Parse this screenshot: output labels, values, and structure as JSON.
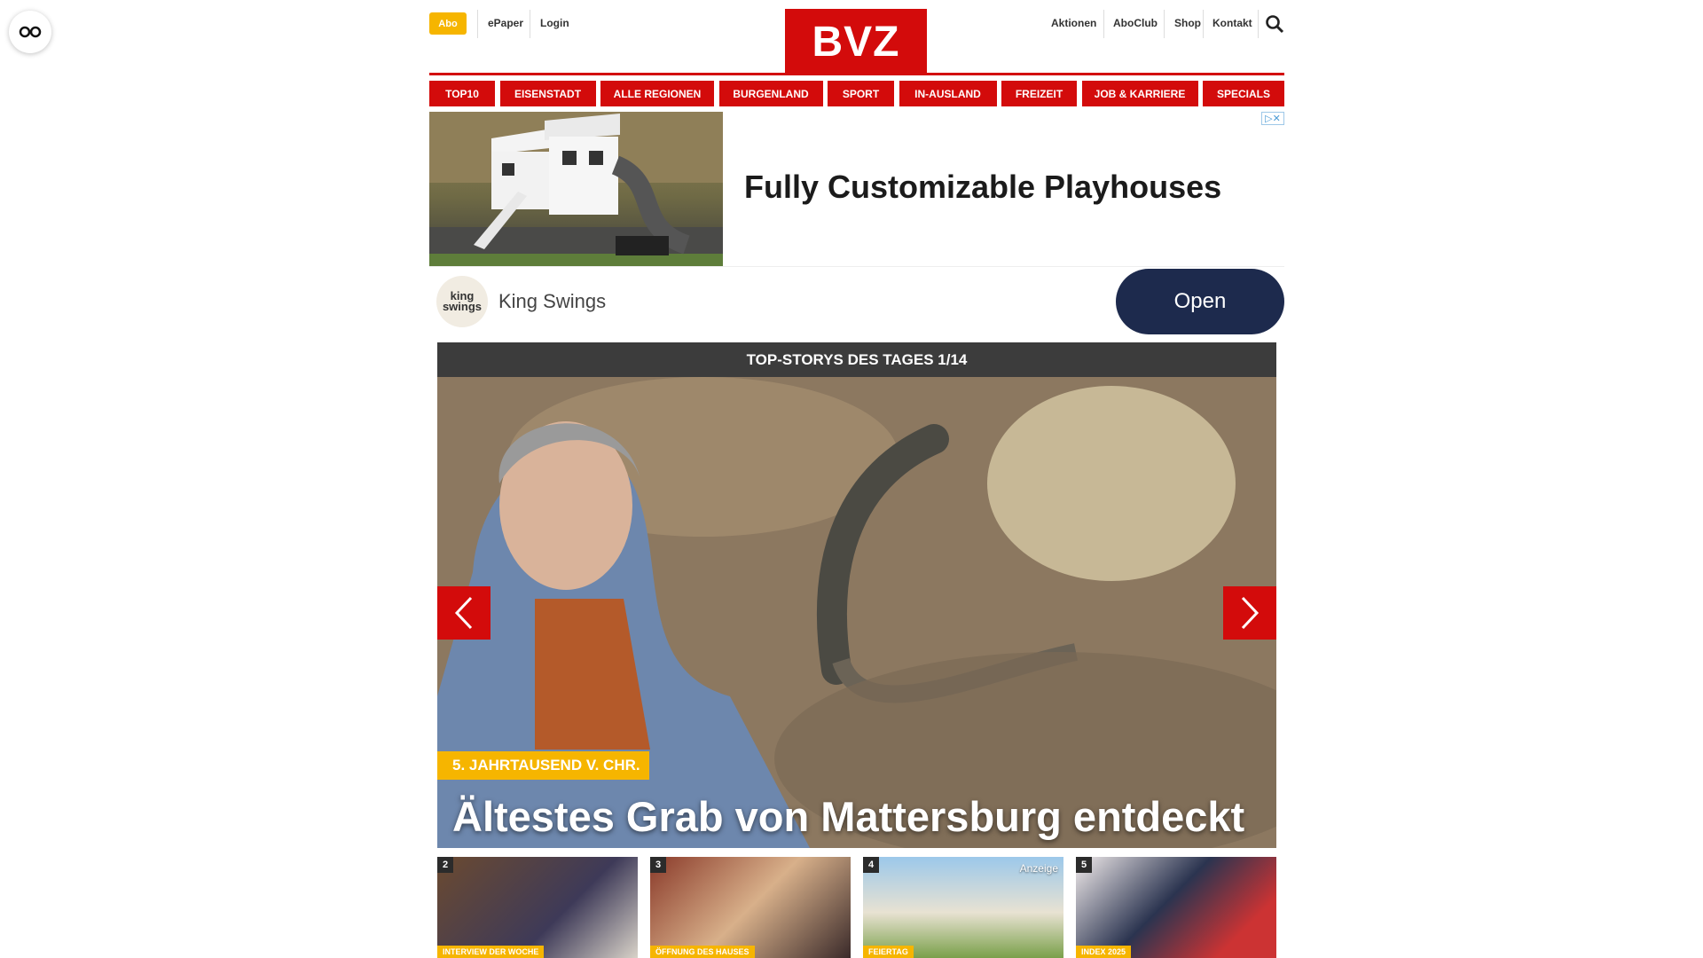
{
  "header": {
    "abo_label": "Abo",
    "epaper_label": "ePaper",
    "login_label": "Login",
    "logo_text": "BVZ",
    "right_links": [
      "Aktionen",
      "AboClub",
      "Shop",
      "Kontakt"
    ]
  },
  "nav": {
    "items": [
      "TOP10",
      "EISENSTADT",
      "ALLE REGIONEN",
      "BURGENLAND",
      "SPORT",
      "IN-AUSLAND",
      "FREIZEIT",
      "JOB & KARRIERE",
      "SPECIALS"
    ]
  },
  "ad": {
    "title": "Fully Customizable Playhouses",
    "logo_line1": "king",
    "logo_line2": "swings",
    "brand": "King Swings",
    "cta": "Open"
  },
  "top_stories": {
    "heading": "TOP-STORYS DES TAGES 1/14",
    "kicker": "5. JAHRTAUSEND V. CHR.",
    "headline": "Ältestes Grab von Mattersburg entdeckt"
  },
  "thumbs": [
    {
      "number": "2",
      "tag": "INTERVIEW DER WOCHE"
    },
    {
      "number": "3",
      "tag": "ÖFFNUNG DES HAUSES"
    },
    {
      "number": "4",
      "tag": "FEIERTAG",
      "badge": "Anzeige"
    },
    {
      "number": "5",
      "tag": "INDEX 2025"
    }
  ],
  "colors": {
    "brand_red": "#d30b0b",
    "accent_yellow": "#f6b500",
    "story_header": "#3c3c3c",
    "ad_button": "#1d2a4d"
  },
  "icons": [
    "reader-glasses-icon",
    "search-icon",
    "chevron-left-icon",
    "chevron-right-icon",
    "ad-choices-icon"
  ]
}
